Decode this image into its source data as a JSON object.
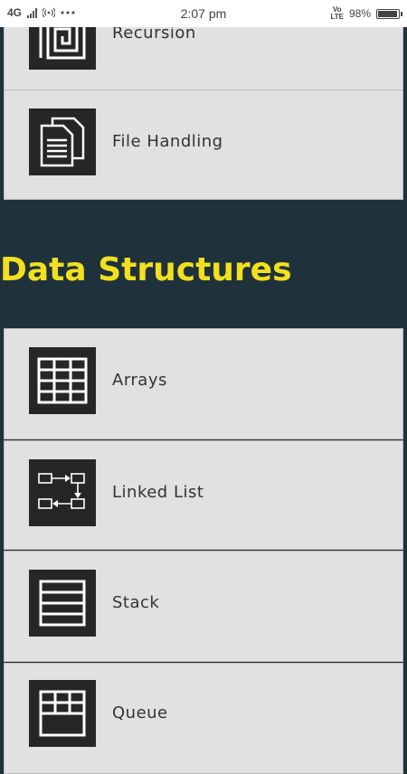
{
  "status_bar": {
    "network": "4G",
    "time": "2:07 pm",
    "volte": [
      "Vo",
      "LTE"
    ],
    "battery_percent": "98%",
    "battery_level": 0.98
  },
  "topics_top": [
    {
      "label": "Recursion",
      "icon": "spiral-icon"
    },
    {
      "label": "File Handling",
      "icon": "documents-icon"
    }
  ],
  "section": {
    "title": "Data Structures"
  },
  "data_structures": [
    {
      "label": "Arrays",
      "icon": "grid-icon"
    },
    {
      "label": "Linked List",
      "icon": "linked-list-icon"
    },
    {
      "label": "Stack",
      "icon": "stack-icon"
    },
    {
      "label": "Queue",
      "icon": "queue-icon"
    }
  ]
}
